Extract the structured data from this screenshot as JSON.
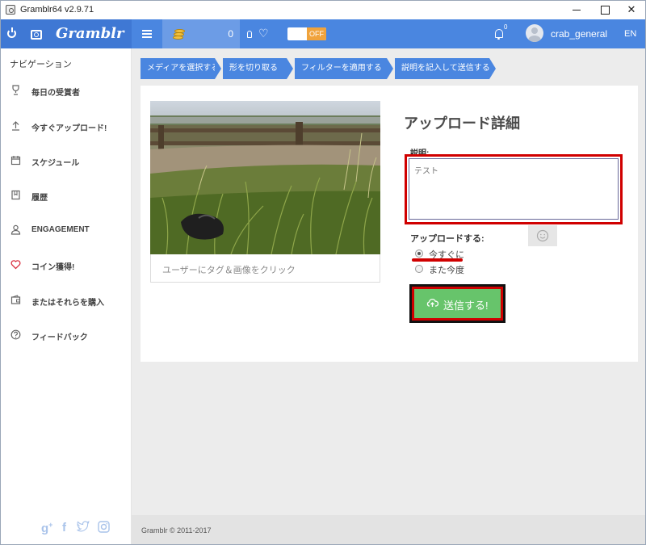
{
  "window": {
    "title": "Gramblr64 v2.9.71"
  },
  "header": {
    "brand": "Gramblr",
    "coins": "0",
    "toggle": "OFF",
    "notifications": "0",
    "username": "crab_general",
    "language": "EN"
  },
  "sidebar": {
    "title": "ナビゲーション",
    "items": [
      {
        "label": "毎日の受賞者",
        "icon": "trophy-icon"
      },
      {
        "label": "今すぐアップロード!",
        "icon": "upload-arrow-icon"
      },
      {
        "label": "スケジュール",
        "icon": "calendar-icon"
      },
      {
        "label": "履歴",
        "icon": "history-icon"
      },
      {
        "label": "ENGAGEMENT",
        "icon": "user-icon"
      },
      {
        "label": "コイン獲得!",
        "icon": "heart-icon"
      },
      {
        "label": "またはそれらを購入",
        "icon": "wallet-icon"
      },
      {
        "label": "フィードバック",
        "icon": "help-icon"
      }
    ]
  },
  "steps": [
    "メディアを選択する",
    "形を切り取る",
    "フィルターを適用する",
    "説明を記入して送信する"
  ],
  "main": {
    "photo_caption": "ユーザーにタグ＆画像をクリック",
    "details_title": "アップロード詳細",
    "description_label": "説明:",
    "description_value": "テスト",
    "upload_label": "アップロードする:",
    "options": [
      "今すぐに",
      "また今度"
    ],
    "selected_option": "今すぐに",
    "submit_label": "送信する!"
  },
  "footer": {
    "copyright": "Gramblr © 2011-2017"
  },
  "colors": {
    "header_blue": "#4a86e0",
    "submit_green": "#67c46b",
    "highlight_red": "#d00000",
    "toggle_orange": "#f0a33c"
  }
}
